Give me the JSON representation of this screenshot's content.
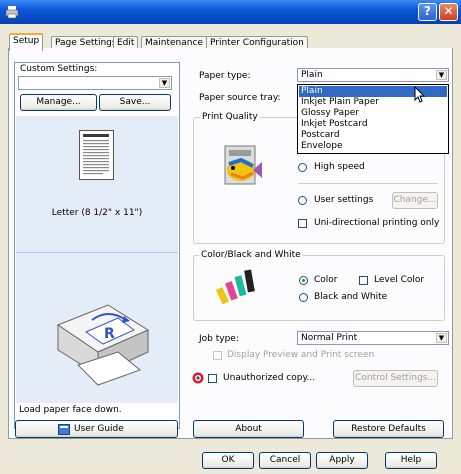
{
  "window": {
    "help_glyph": "?",
    "close_glyph": "✕"
  },
  "tabs": [
    {
      "label": "Setup"
    },
    {
      "label": "Page Settings"
    },
    {
      "label": "Edit"
    },
    {
      "label": "Maintenance"
    },
    {
      "label": "Printer Configuration"
    }
  ],
  "custom_settings": {
    "label": "Custom Settings:",
    "value": "",
    "manage_label": "Manage...",
    "save_label": "Save..."
  },
  "paper_preview_label": "Letter (8 1/2\" x 11\")",
  "instruction_text": "Load paper face down.",
  "user_guide_label": "User Guide",
  "paper_type": {
    "label": "Paper type:",
    "value": "Plain",
    "options": [
      "Plain",
      "Inkjet Plain Paper",
      "Glossy Paper",
      "Inkjet Postcard",
      "Postcard",
      "Envelope"
    ],
    "selected_index": 0
  },
  "paper_source": {
    "label": "Paper source tray:"
  },
  "print_quality": {
    "legend": "Print Quality",
    "high_speed": "High speed",
    "user_settings": "User settings",
    "change_label": "Change...",
    "uni_directional": "Uni-directional printing only"
  },
  "color_bw": {
    "legend": "Color/Black and White",
    "color": "Color",
    "level_color": "Level Color",
    "bw": "Black and White",
    "selected": "color"
  },
  "job_type": {
    "label": "Job type:",
    "value": "Normal Print",
    "preview_label": "Display Preview and Print screen"
  },
  "unauthorized": {
    "label": "Unauthorized copy...",
    "control_label": "Control Settings..."
  },
  "about_label": "About",
  "restore_label": "Restore Defaults",
  "footer": {
    "ok": "OK",
    "cancel": "Cancel",
    "apply": "Apply",
    "help": "Help"
  },
  "colors": {
    "title_bar": "#0a58d8",
    "selection": "#316ac5",
    "accent_tab": "#f7a940",
    "left_panel": "#e4ecf8"
  }
}
